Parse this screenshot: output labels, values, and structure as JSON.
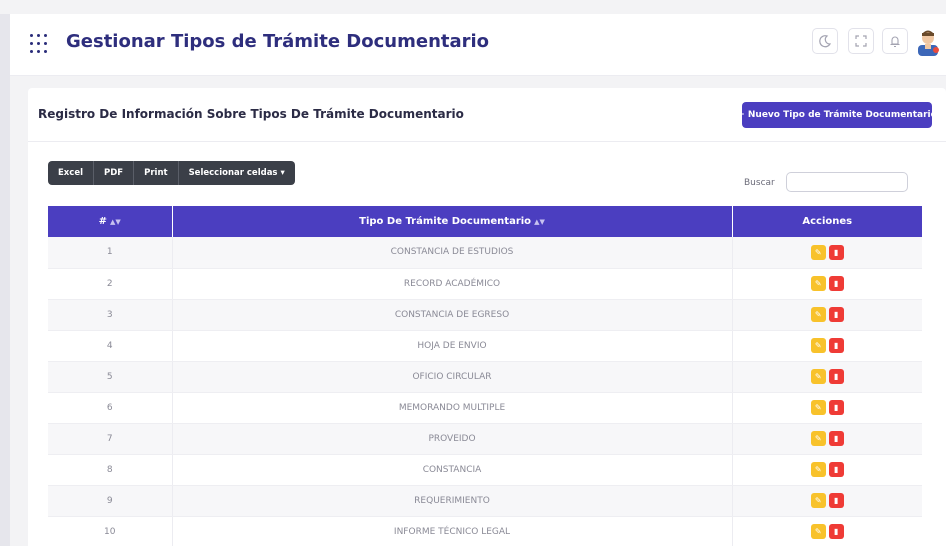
{
  "header": {
    "title": "Gestionar Tipos de Trámite Documentario",
    "icons": [
      "apps-grid-icon",
      "moon-icon",
      "fullscreen-icon",
      "bell-icon",
      "user-avatar"
    ]
  },
  "card": {
    "title": "Registro De Información Sobre Tipos De Trámite Documentario",
    "new_button": "+ Nuevo Tipo de Trámite Documentario"
  },
  "toolbar": {
    "excel": "Excel",
    "pdf": "PDF",
    "print": "Print",
    "select_cells": "Seleccionar celdas ▾"
  },
  "search": {
    "label": "Buscar",
    "value": ""
  },
  "table": {
    "columns": [
      "#",
      "Tipo De Trámite Documentario",
      "Acciones"
    ],
    "rows": [
      {
        "n": "1",
        "tipo": "CONSTANCIA DE ESTUDIOS"
      },
      {
        "n": "2",
        "tipo": "RECORD ACADÉMICO"
      },
      {
        "n": "3",
        "tipo": "CONSTANCIA DE EGRESO"
      },
      {
        "n": "4",
        "tipo": "HOJA DE ENVIO"
      },
      {
        "n": "5",
        "tipo": "OFICIO CIRCULAR"
      },
      {
        "n": "6",
        "tipo": "MEMORANDO MULTIPLE"
      },
      {
        "n": "7",
        "tipo": "PROVEIDO"
      },
      {
        "n": "8",
        "tipo": "CONSTANCIA"
      },
      {
        "n": "9",
        "tipo": "REQUERIMIENTO"
      },
      {
        "n": "10",
        "tipo": "INFORME TÉCNICO LEGAL"
      }
    ]
  },
  "colors": {
    "accent": "#4b3ec0",
    "title": "#2e2e7d",
    "edit": "#f8c22b",
    "delete": "#ef3b36",
    "toolbar_dark": "#3b3f48"
  }
}
